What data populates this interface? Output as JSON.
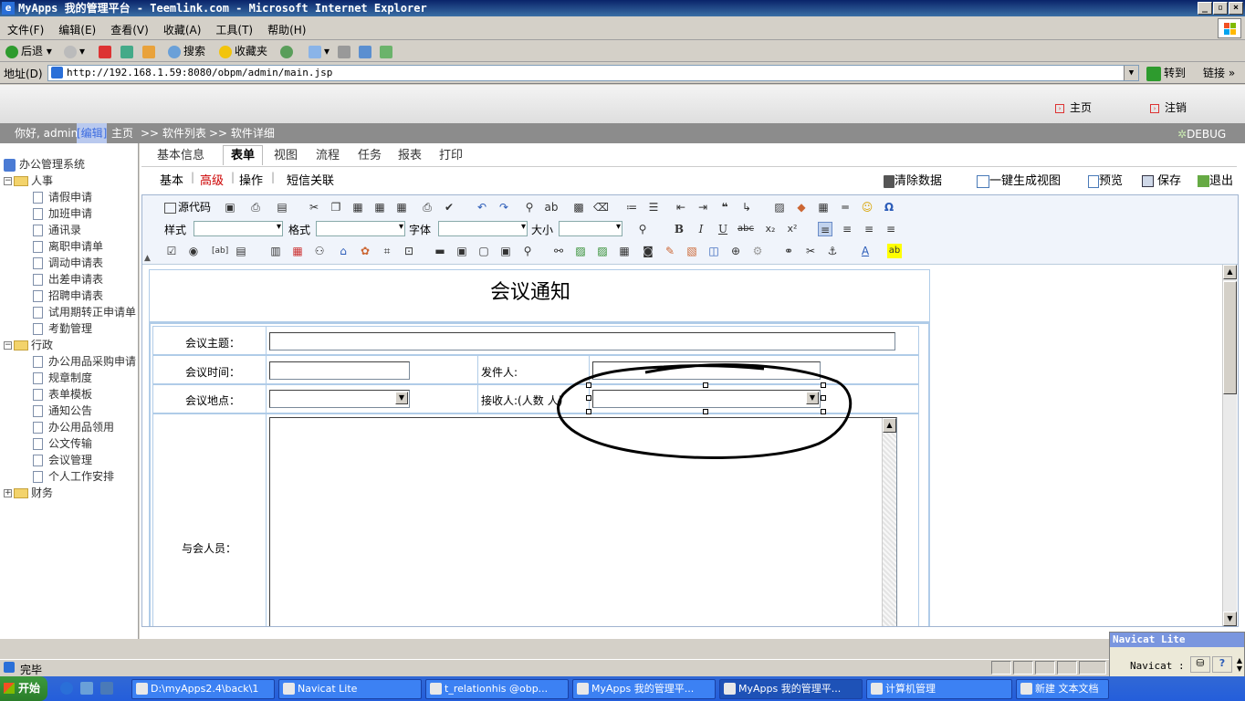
{
  "window": {
    "title": "MyApps 我的管理平台 - Teemlink.com - Microsoft Internet Explorer",
    "buttons": [
      "_",
      "▫",
      "×"
    ]
  },
  "menu": [
    "文件(F)",
    "编辑(E)",
    "查看(V)",
    "收藏(A)",
    "工具(T)",
    "帮助(H)"
  ],
  "toolbar": {
    "back": "后退",
    "search": "搜索",
    "favorites": "收藏夹"
  },
  "address": {
    "label": "地址(D)",
    "url": "http://192.168.1.59:8080/obpm/admin/main.jsp",
    "go": "转到",
    "links": "链接"
  },
  "header": {
    "home": "主页",
    "logout": "注销"
  },
  "navbar": {
    "greeting": "你好, admin",
    "edit": "[编辑]",
    "home": "主页",
    "crumb1": ">> 软件列表",
    "crumb2": ">> 软件详细",
    "debug": "DEBUG"
  },
  "tree": {
    "root": "办公管理系统",
    "groups": [
      {
        "label": "人事",
        "items": [
          "请假申请",
          "加班申请",
          "通讯录",
          "离职申请单",
          "调动申请表",
          "出差申请表",
          "招聘申请表",
          "试用期转正申请单",
          "考勤管理"
        ]
      },
      {
        "label": "行政",
        "items": [
          "办公用品采购申请",
          "规章制度",
          "表单模板",
          "通知公告",
          "办公用品领用",
          "公文传输",
          "会议管理",
          "个人工作安排"
        ]
      },
      {
        "label": "财务",
        "items": []
      }
    ]
  },
  "tabs": [
    "基本信息",
    "表单",
    "视图",
    "流程",
    "任务",
    "报表",
    "打印"
  ],
  "subtabs": [
    "基本",
    "高级",
    "操作",
    "短信关联"
  ],
  "actions": {
    "clear": "清除数据",
    "genview": "一键生成视图",
    "preview": "预览",
    "save": "保存",
    "exit": "退出"
  },
  "editor": {
    "source": "源代码",
    "style": "样式",
    "format": "格式",
    "font": "字体",
    "size": "大小"
  },
  "form": {
    "title": "会议通知",
    "subject_label": "会议主题：",
    "time_label": "会议时间：",
    "sender_label": "发件人:",
    "place_label": "会议地点：",
    "receiver_label": "接收人:(人数",
    "receiver_label2": "人)",
    "attendees_label": "与会人员："
  },
  "status": {
    "done": "完毕"
  },
  "taskbar": {
    "start": "开始",
    "tasks": [
      "D:\\myApps2.4\\back\\1",
      "Navicat Lite",
      "t_relationhis @obp...",
      "MyApps 我的管理平...",
      "MyApps 我的管理平...",
      "计算机管理",
      "新建 文本文档"
    ]
  },
  "navicat": {
    "title": "Navicat Lite",
    "text": "Navicat :"
  }
}
